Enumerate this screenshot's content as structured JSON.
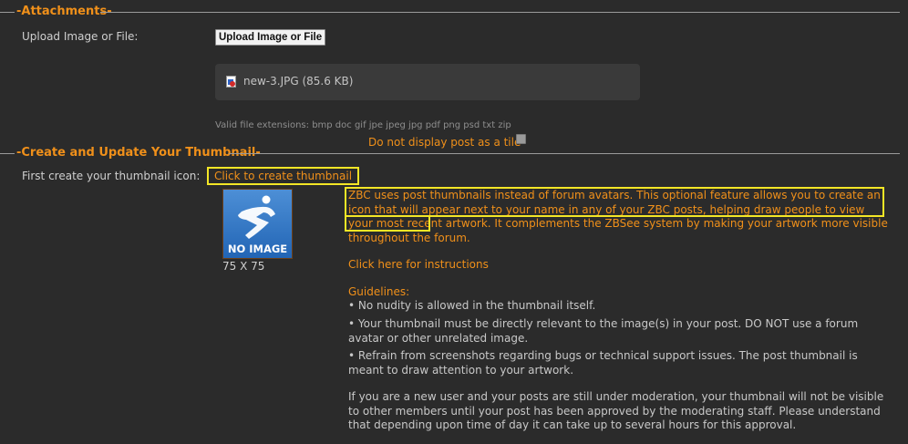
{
  "attachments": {
    "legend": "-Attachments-",
    "upload_label": "Upload Image or File:",
    "upload_button": "Upload Image or File",
    "file": {
      "icon": "image-file-icon",
      "name": "new-3.JPG (85.6 KB)"
    },
    "valid_extensions": "Valid file extensions: bmp doc gif jpe jpeg jpg pdf png psd txt zip",
    "no_tile_label": "Do not display post as a tile",
    "no_tile_checked": false
  },
  "thumbnail": {
    "legend": "-Create and Update Your Thumbnail-",
    "first_label": "First create your thumbnail icon:",
    "create_link": "Click to create thumbnail",
    "image_text": "NO IMAGE",
    "image_icon": "zbrush-figure-icon",
    "size": "75 X 75",
    "description": "ZBC uses post thumbnails instead of forum avatars. This optional feature allows you to create an icon that will appear next to your name in any of your ZBC posts, helping draw people to view your most recent artwork. It complements the ZBSee system by making your artwork more visible throughout the forum.",
    "instructions_link": "Click here for instructions",
    "guidelines_title": "Guidelines:",
    "guidelines": [
      "• No nudity is allowed in the thumbnail itself.",
      "• Your thumbnail must be directly relevant to the image(s) in your post. DO NOT use a forum avatar or other unrelated image.",
      "• Refrain from screenshots regarding bugs or technical support issues. The post thumbnail is meant to draw attention to your artwork."
    ],
    "moderation_note": "If you are a new user and your posts are still under moderation, your thumbnail will not be visible to other members until your post has been approved by the moderating staff. Please understand that depending upon time of day it can take up to several hours for this approval."
  },
  "colors": {
    "background": "#2b2b2b",
    "accent": "#f0901a",
    "highlight": "#f3e626",
    "text": "#c8c8c8"
  }
}
